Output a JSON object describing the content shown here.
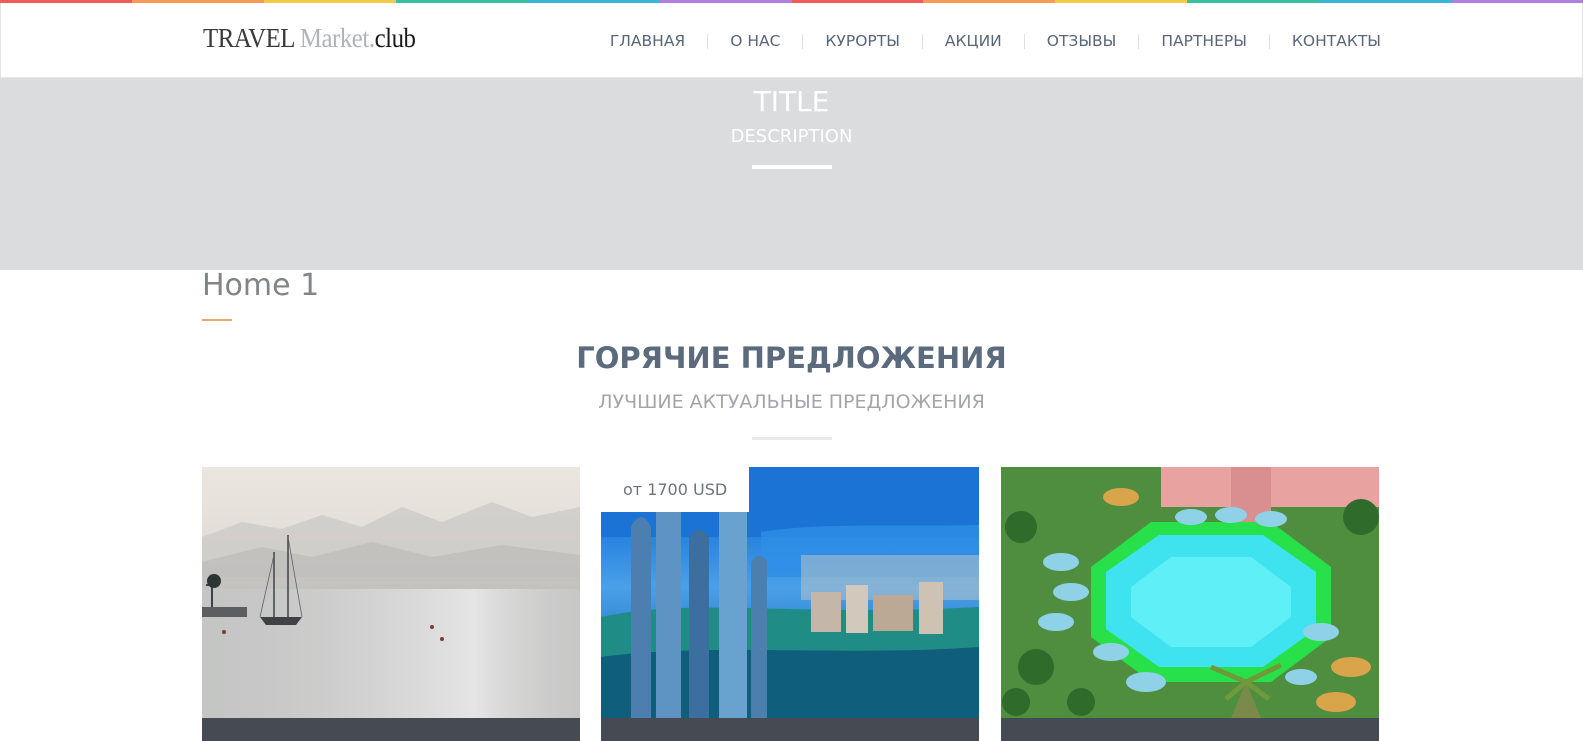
{
  "rainbow_colors": [
    "#ef5b5b",
    "#f79a55",
    "#f7c948",
    "#38c0a2",
    "#3cb6d6",
    "#b07fe0",
    "#ef5b5b",
    "#f79a55",
    "#f7c948",
    "#38c0a2",
    "#3cb6d6",
    "#b07fe0"
  ],
  "header": {
    "logo": {
      "part1": "TRAVEL ",
      "part2": "Market.",
      "part3": "club"
    },
    "nav": [
      {
        "label": "ГЛАВНАЯ"
      },
      {
        "label": "О НАС"
      },
      {
        "label": "КУРОРТЫ"
      },
      {
        "label": "АКЦИИ"
      },
      {
        "label": "ОТЗЫВЫ"
      },
      {
        "label": "ПАРТНЕРЫ"
      },
      {
        "label": "КОНТАКТЫ"
      }
    ]
  },
  "hero": {
    "title": "TITLE",
    "description": "DESCRIPTION"
  },
  "page": {
    "heading": "Home 1"
  },
  "section": {
    "title": "ГОРЯЧИЕ ПРЕДЛОЖЕНИЯ",
    "subtitle": "ЛУЧШИЕ АКТУАЛЬНЫЕ ПРЕДЛОЖЕНИЯ"
  },
  "cards": [
    {
      "image": "misty-sea-sailboat-photo",
      "price": "",
      "caption": ""
    },
    {
      "image": "coastal-city-skyscrapers-photo",
      "price": "от 1700 USD",
      "caption": ""
    },
    {
      "image": "resort-pool-umbrellas-photo",
      "price": "",
      "caption": ""
    }
  ],
  "colors": {
    "nav_text": "#5a6678",
    "hero_bg": "#dbdcde",
    "heading_accent": "#f0a86a",
    "section_title": "#5c6a7e",
    "card_bar": "#464a52"
  }
}
